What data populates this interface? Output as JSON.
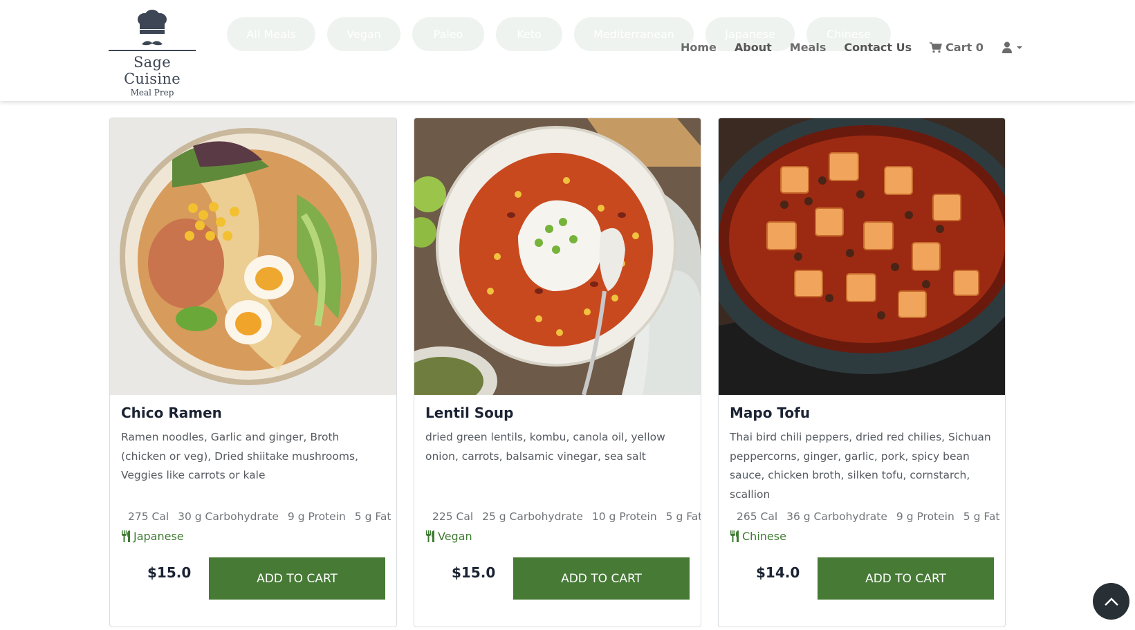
{
  "brand": {
    "name": "Sage Cuisine",
    "tagline": "Meal Prep"
  },
  "filters": [
    "All Meals",
    "Vegan",
    "Paleo",
    "Keto",
    "Mediterranean",
    "Japanese",
    "Chinese"
  ],
  "nav": {
    "home": "Home",
    "about": "About",
    "meals": "Meals",
    "contact": "Contact Us",
    "cart_label": "Cart 0"
  },
  "meals": [
    {
      "name": "Chico Ramen",
      "description": "Ramen noodles, Garlic and ginger, Broth (chicken or veg), Dried shiitake mushrooms, Veggies like carrots or kale",
      "calories": "275 Cal",
      "carbs": "30 g Carbohydrate",
      "protein": "9 g Protein",
      "fat": "5 g Fat",
      "cuisine": "Japanese",
      "price": "$15.0",
      "button": "ADD TO CART"
    },
    {
      "name": "Lentil Soup",
      "description": "dried green lentils, kombu, canola oil, yellow onion, carrots, balsamic vinegar, sea salt",
      "calories": "225 Cal",
      "carbs": "25 g Carbohydrate",
      "protein": "10 g Protein",
      "fat": "5 g Fat",
      "cuisine": "Vegan",
      "price": "$15.0",
      "button": "ADD TO CART"
    },
    {
      "name": "Mapo Tofu",
      "description": "Thai bird chili peppers, dried red chilies, Sichuan peppercorns, ginger, garlic, pork, spicy bean sauce, chicken broth, silken tofu, cornstarch, scallion",
      "calories": "265 Cal",
      "carbs": "36 g Carbohydrate",
      "protein": "9 g Protein",
      "fat": "5 g Fat",
      "cuisine": "Chinese",
      "price": "$14.0",
      "button": "ADD TO CART"
    }
  ],
  "icons": {
    "logo": "chef-hat-mustache-icon",
    "cart": "shopping-cart-icon",
    "user": "user-icon",
    "cuisine": "utensils-icon",
    "scroll": "chevron-up-icon"
  },
  "colors": {
    "accent": "#467a35",
    "cuisine_text": "#3e7b32",
    "chip_bg": "#eef3ef",
    "scroll_btn": "#283035"
  }
}
